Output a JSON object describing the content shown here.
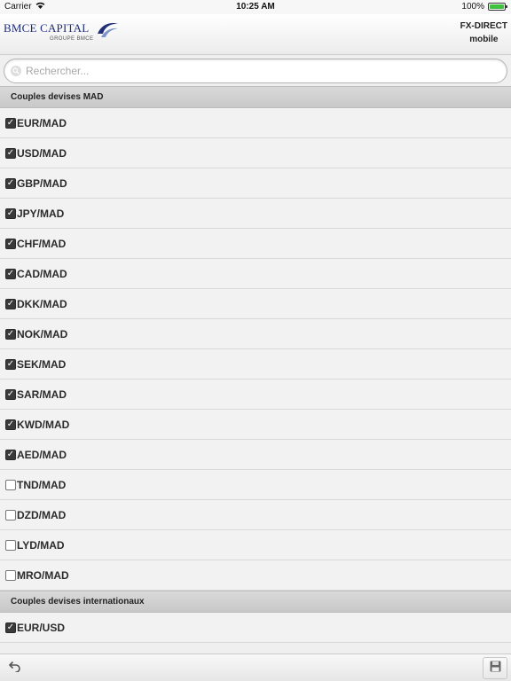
{
  "status_bar": {
    "carrier": "Carrier",
    "time": "10:25 AM",
    "battery_percent": "100%"
  },
  "header": {
    "logo_text": "BMCE CAPITAL",
    "logo_subtext": "GROUPE BMCE",
    "app_name_line1": "FX-DIRECT",
    "app_name_line2": "mobile"
  },
  "search": {
    "placeholder": "Rechercher...",
    "value": ""
  },
  "sections": [
    {
      "title": "Couples devises MAD",
      "items": [
        {
          "label": "EUR/MAD",
          "checked": true
        },
        {
          "label": "USD/MAD",
          "checked": true
        },
        {
          "label": "GBP/MAD",
          "checked": true
        },
        {
          "label": "JPY/MAD",
          "checked": true
        },
        {
          "label": "CHF/MAD",
          "checked": true
        },
        {
          "label": "CAD/MAD",
          "checked": true
        },
        {
          "label": "DKK/MAD",
          "checked": true
        },
        {
          "label": "NOK/MAD",
          "checked": true
        },
        {
          "label": "SEK/MAD",
          "checked": true
        },
        {
          "label": "SAR/MAD",
          "checked": true
        },
        {
          "label": "KWD/MAD",
          "checked": true
        },
        {
          "label": "AED/MAD",
          "checked": true
        },
        {
          "label": "TND/MAD",
          "checked": false
        },
        {
          "label": "DZD/MAD",
          "checked": false
        },
        {
          "label": "LYD/MAD",
          "checked": false
        },
        {
          "label": "MRO/MAD",
          "checked": false
        }
      ]
    },
    {
      "title": "Couples devises internationaux",
      "items": [
        {
          "label": "EUR/USD",
          "checked": true
        }
      ]
    }
  ],
  "footer": {
    "undo_icon": "undo-arrow-icon",
    "save_icon": "floppy-disk-icon"
  },
  "colors": {
    "brand": "#1f2e7a",
    "battery": "#3ec23e"
  }
}
